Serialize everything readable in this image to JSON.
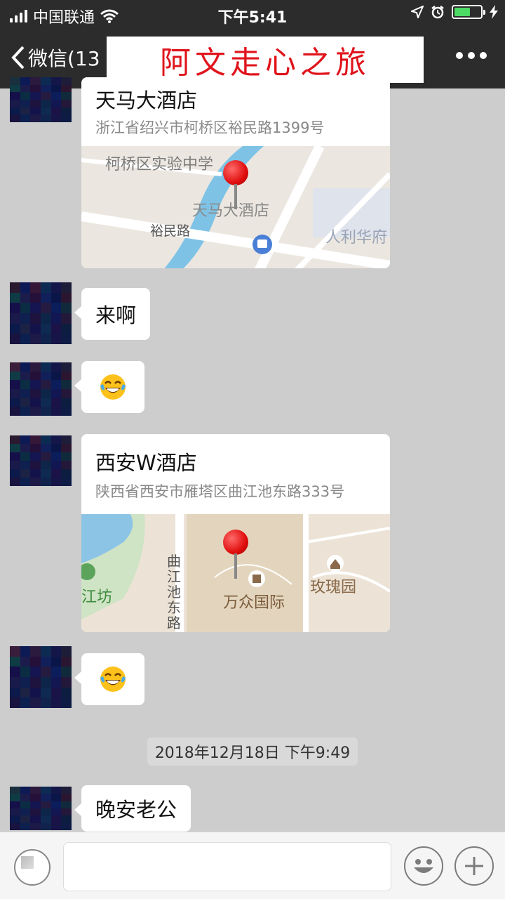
{
  "status_bar": {
    "carrier": "中国联通",
    "time": "下午5:41",
    "icons": [
      "signal-icon",
      "wifi-icon",
      "location-arrow-icon",
      "alarm-icon",
      "battery-icon",
      "charging-icon"
    ],
    "battery_level": 0.6,
    "battery_color": "#4cd964"
  },
  "nav": {
    "back_label": "微信(13",
    "title_banner": "阿文走心之旅",
    "title_color": "#e0141c",
    "more_icon": "more-icon"
  },
  "messages": [
    {
      "type": "location",
      "name": "天马大酒店",
      "address": "浙江省绍兴市柯桥区裕民路1399号",
      "map_labels": [
        "柯桥区实验中学",
        "天马大酒店",
        "裕民路",
        "人利华府"
      ]
    },
    {
      "type": "text",
      "text": "来啊"
    },
    {
      "type": "emoji",
      "emoji": "😂"
    },
    {
      "type": "location",
      "name": "西安W酒店",
      "address": "陕西省西安市雁塔区曲江池东路333号",
      "map_labels": [
        "曲江池东路",
        "万众国际",
        "玫瑰园",
        "江坊"
      ]
    },
    {
      "type": "emoji",
      "emoji": "😂"
    },
    {
      "type": "timestamp",
      "text": "2018年12月18日 下午9:49"
    },
    {
      "type": "text",
      "text": "晚安老公"
    }
  ],
  "input_bar": {
    "icons": [
      "voice-icon",
      "emoji-icon",
      "plus-icon"
    ]
  }
}
